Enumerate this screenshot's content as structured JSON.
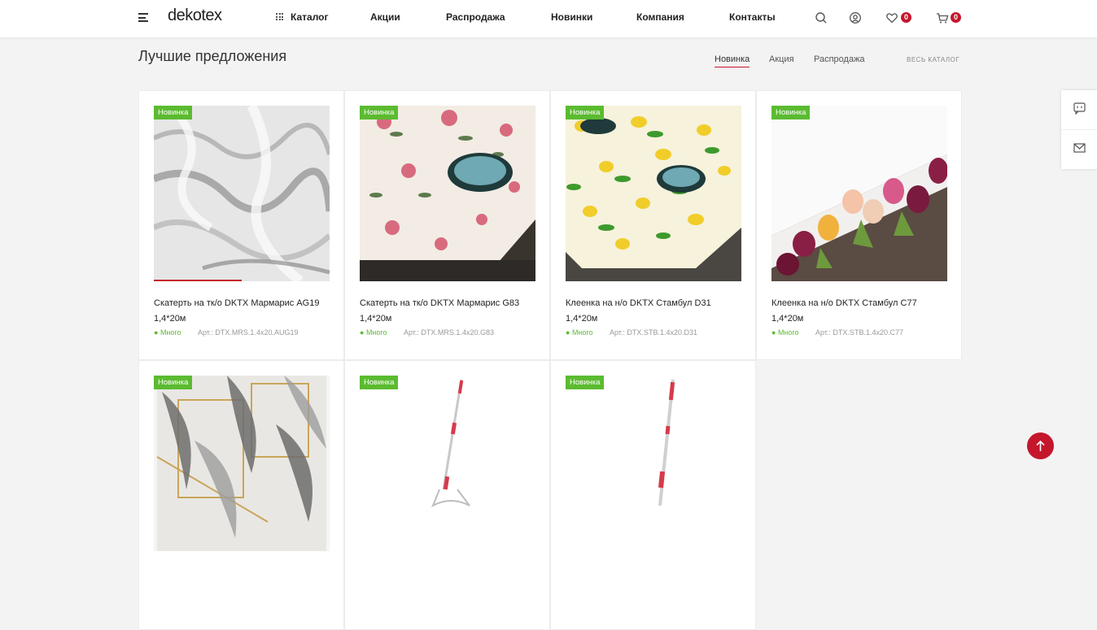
{
  "header": {
    "logo": "dekotex",
    "nav": [
      "Каталог",
      "Акции",
      "Распродажа",
      "Новинки",
      "Компания",
      "Контакты"
    ],
    "wishlist_count": "0",
    "cart_count": "0"
  },
  "section": {
    "title": "Лучшие предложения",
    "filters": [
      "Новинка",
      "Акция",
      "Распродажа"
    ],
    "active_filter": "Новинка",
    "catalog_link": "ВЕСЬ КАТАЛОГ"
  },
  "products": [
    {
      "tag": "Новинка",
      "name": "Скатерть на тк/о DKTX Мармарис AG19 1,4*20м",
      "stock": "Много",
      "article": "Арт.: DTX.MRS.1.4x20.AUG19"
    },
    {
      "tag": "Новинка",
      "name": "Скатерть на тк/о DKTX Мармарис G83 1,4*20м",
      "stock": "Много",
      "article": "Арт.: DTX.MRS.1.4x20.G83"
    },
    {
      "tag": "Новинка",
      "name": "Клеенка на н/о DKTX Стамбул D31 1,4*20м",
      "stock": "Много",
      "article": "Арт.: DTX.STB.1.4x20.D31"
    },
    {
      "tag": "Новинка",
      "name": "Клеенка на н/о DKTX Стамбул C77 1,4*20м",
      "stock": "Много",
      "article": "Арт.: DTX.STB.1.4x20.C77"
    },
    {
      "tag": "Новинка"
    },
    {
      "tag": "Новинка"
    },
    {
      "tag": "Новинка"
    }
  ],
  "colors": {
    "accent": "#c4172c",
    "new_tag": "#5bbb30",
    "background": "#f3f3f3"
  },
  "icons": [
    "menu-icon",
    "catalog-grid-icon",
    "search-icon",
    "user-icon",
    "heart-icon",
    "cart-icon",
    "chat-icon",
    "mail-icon",
    "arrow-up-icon"
  ]
}
